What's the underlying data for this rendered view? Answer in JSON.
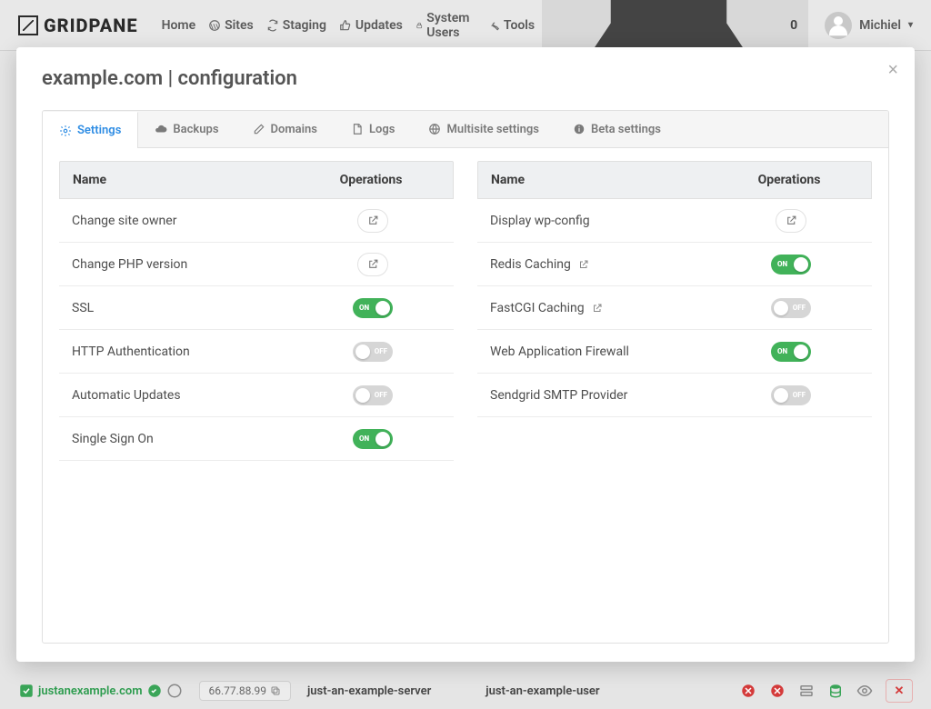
{
  "brand": "GRIDPANE",
  "nav": {
    "home": "Home",
    "sites": "Sites",
    "staging": "Staging",
    "updates": "Updates",
    "system_users": "System Users",
    "tools": "Tools"
  },
  "notifications": {
    "count": "0"
  },
  "user": {
    "name": "Michiel"
  },
  "modal": {
    "title": "example.com | configuration",
    "tabs": {
      "settings": "Settings",
      "backups": "Backups",
      "domains": "Domains",
      "logs": "Logs",
      "multisite": "Multisite settings",
      "beta": "Beta settings"
    },
    "columns": {
      "name": "Name",
      "operations": "Operations"
    },
    "left": [
      {
        "label": "Change site owner",
        "control": "link"
      },
      {
        "label": "Change PHP version",
        "control": "link"
      },
      {
        "label": "SSL",
        "control": "toggle",
        "state": "on"
      },
      {
        "label": "HTTP Authentication",
        "control": "toggle",
        "state": "off"
      },
      {
        "label": "Automatic Updates",
        "control": "toggle",
        "state": "off"
      },
      {
        "label": "Single Sign On",
        "control": "toggle",
        "state": "on"
      }
    ],
    "right": [
      {
        "label": "Display wp-config",
        "control": "link"
      },
      {
        "label": "Redis Caching",
        "control": "toggle",
        "state": "on",
        "ext": true
      },
      {
        "label": "FastCGI Caching",
        "control": "toggle",
        "state": "off",
        "ext": true
      },
      {
        "label": "Web Application Firewall",
        "control": "toggle",
        "state": "on"
      },
      {
        "label": "Sendgrid SMTP Provider",
        "control": "toggle",
        "state": "off"
      }
    ]
  },
  "bg_row": {
    "domain": "justanexample.com",
    "ip": "66.77.88.99",
    "server": "just-an-example-server",
    "user": "just-an-example-user"
  },
  "toggle_labels": {
    "on": "ON",
    "off": "OFF"
  }
}
